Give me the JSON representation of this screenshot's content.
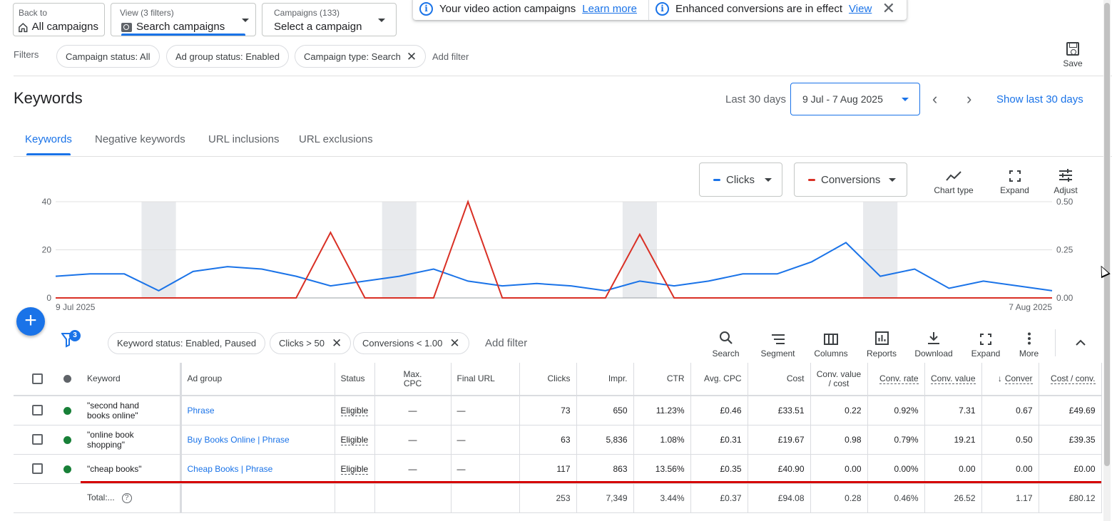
{
  "header": {
    "back": {
      "small": "Back to",
      "label": "All campaigns"
    },
    "view": {
      "small": "View (3 filters)",
      "label": "Search campaigns"
    },
    "campaigns": {
      "small": "Campaigns (133)",
      "label": "Select a campaign"
    }
  },
  "banner": {
    "left_text": "Your video action campaigns",
    "left_link": "Learn more",
    "right_text": "Enhanced conversions are in effect",
    "right_link": "View",
    "close": "✕"
  },
  "filters": {
    "label": "Filters",
    "chips": [
      "Campaign status: All",
      "Ad group status: Enabled",
      "Campaign type: Search"
    ],
    "add": "Add filter",
    "save": "Save"
  },
  "title_row": {
    "title": "Keywords",
    "range_label": "Last 30 days",
    "date_range": "9 Jul - 7 Aug 2025",
    "show_last": "Show last 30 days"
  },
  "tabs": [
    "Keywords",
    "Negative keywords",
    "URL inclusions",
    "URL exclusions"
  ],
  "chart_controls": {
    "metric1": "Clicks",
    "metric2": "Conversions",
    "tools": [
      "Chart type",
      "Expand",
      "Adjust"
    ]
  },
  "colors": {
    "clicks": "#1a73e8",
    "conversions": "#d93025",
    "accent": "#1a73e8"
  },
  "chart_data": {
    "type": "line",
    "x_start": "9 Jul 2025",
    "x_end": "7 Aug 2025",
    "grid": true,
    "weekend_shading": true,
    "left_axis": {
      "ticks": [
        "40",
        "20",
        "0"
      ],
      "ylim": [
        0,
        40
      ]
    },
    "right_axis": {
      "ticks": [
        "0.50",
        "0.25",
        "0.00"
      ],
      "ylim": [
        0,
        0.5
      ]
    },
    "series": [
      {
        "name": "Clicks",
        "axis": "left",
        "values": [
          9,
          10,
          10,
          3,
          11,
          13,
          12,
          9,
          5,
          7,
          9,
          12,
          7,
          5,
          6,
          5,
          3,
          7,
          5,
          7,
          10,
          10,
          15,
          23,
          9,
          12,
          4,
          7,
          5,
          3
        ]
      },
      {
        "name": "Conversions",
        "axis": "right",
        "values": [
          0,
          0,
          0,
          0,
          0,
          0,
          0,
          0,
          0.34,
          0,
          0,
          0,
          0.5,
          0,
          0,
          0,
          0,
          0.33,
          0,
          0,
          0,
          0,
          0,
          0,
          0,
          0,
          0,
          0,
          0,
          0
        ]
      }
    ]
  },
  "table_toolbar": {
    "filter_count": "3",
    "chips": [
      "Keyword status: Enabled, Paused",
      "Clicks > 50",
      "Conversions < 1.00"
    ],
    "add": "Add filter",
    "tools": [
      "Search",
      "Segment",
      "Columns",
      "Reports",
      "Download",
      "Expand",
      "More"
    ]
  },
  "table": {
    "headers": {
      "keyword": "Keyword",
      "ad_group": "Ad group",
      "status": "Status",
      "max_cpc_1": "Max.",
      "max_cpc_2": "CPC",
      "final_url": "Final URL",
      "clicks": "Clicks",
      "impr": "Impr.",
      "ctr": "CTR",
      "avg_cpc": "Avg. CPC",
      "cost": "Cost",
      "cvc_1": "Conv. value",
      "cvc_2": "/ cost",
      "conv_rate": "Conv. rate",
      "conv_value": "Conv. value",
      "conv": "Conver",
      "cost_conv": "Cost / conv."
    },
    "rows": [
      {
        "keyword": "\"second hand books online\"",
        "ad_group": "Phrase",
        "status": "Eligible",
        "max_cpc": "—",
        "final_url": "—",
        "clicks": "73",
        "impr": "650",
        "ctr": "11.23%",
        "avg_cpc": "£0.46",
        "cost": "£33.51",
        "cvc": "0.22",
        "conv_rate": "0.92%",
        "conv_value": "7.31",
        "conv": "0.67",
        "cost_conv": "£49.69"
      },
      {
        "keyword": "\"online book shopping\"",
        "ad_group": "Buy Books Online | Phrase",
        "status": "Eligible",
        "max_cpc": "—",
        "final_url": "—",
        "clicks": "63",
        "impr": "5,836",
        "ctr": "1.08%",
        "avg_cpc": "£0.31",
        "cost": "£19.67",
        "cvc": "0.98",
        "conv_rate": "0.79%",
        "conv_value": "19.21",
        "conv": "0.50",
        "cost_conv": "£39.35"
      },
      {
        "keyword": "\"cheap books\"",
        "ad_group": "Cheap Books | Phrase",
        "status": "Eligible",
        "max_cpc": "—",
        "final_url": "—",
        "clicks": "117",
        "impr": "863",
        "ctr": "13.56%",
        "avg_cpc": "£0.35",
        "cost": "£40.90",
        "cvc": "0.00",
        "conv_rate": "0.00%",
        "conv_value": "0.00",
        "conv": "0.00",
        "cost_conv": "£0.00"
      }
    ],
    "total": {
      "label": "Total:...",
      "clicks": "253",
      "impr": "7,349",
      "ctr": "3.44%",
      "avg_cpc": "£0.37",
      "cost": "£94.08",
      "cvc": "0.28",
      "conv_rate": "0.46%",
      "conv_value": "26.52",
      "conv": "1.17",
      "cost_conv": "£80.12"
    }
  }
}
